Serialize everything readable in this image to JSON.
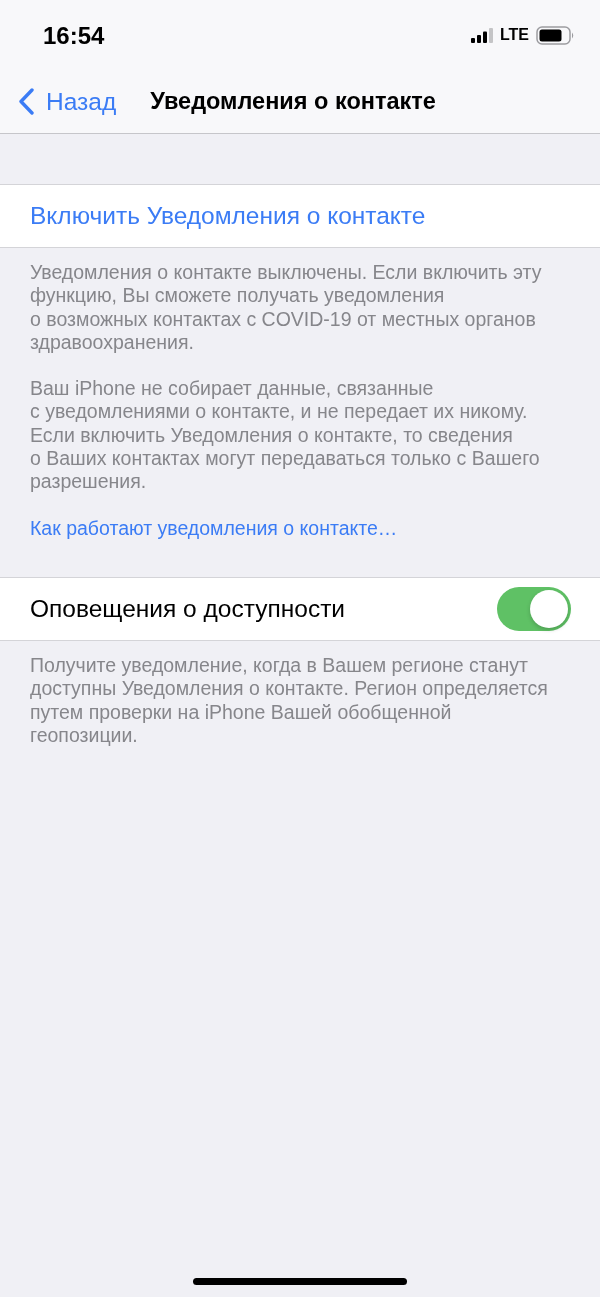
{
  "status_bar": {
    "time": "16:54",
    "network": "LTE"
  },
  "nav_bar": {
    "back": "Назад",
    "title": "Уведомления о контакте"
  },
  "groups": [
    {
      "cells": [
        {
          "kind": "action",
          "label": "Включить Уведомления о контакте"
        }
      ],
      "footer": {
        "paragraphs": [
          "Уведомления о контакте выключены. Если включить эту\nфункцию, Вы сможете получать уведомления\nо возможных контактах с COVID-19 от местных органов\nздравоохранения.",
          "Ваш iPhone не собирает данные, связанные\nс уведомлениями о контакте, и не передает их никому.\nЕсли включить Уведомления о контакте, то сведения\nо Ваших контактах могут передаваться только с Вашего\nразрешения."
        ],
        "link": "Как работают уведомления о контакте…"
      }
    },
    {
      "cells": [
        {
          "kind": "toggle",
          "label": "Оповещения о доступности",
          "on": true
        }
      ],
      "footer": {
        "paragraphs": [
          "Получите уведомление, когда в Вашем регионе станут\nдоступны Уведомления о контакте. Регион определяется\nпутем проверки на iPhone Вашей обобщенной\nгеопозиции."
        ]
      }
    }
  ]
}
